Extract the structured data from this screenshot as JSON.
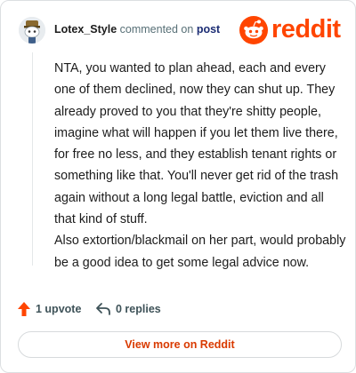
{
  "header": {
    "username": "Lotex_Style",
    "action_text": "commented on",
    "post_link": "post"
  },
  "brand": {
    "wordmark": "reddit",
    "color": "#ff4500"
  },
  "comment": {
    "paragraphs": [
      "NTA, you wanted to plan ahead, each and every one of them declined, now they can shut up. They already proved to you that they're shitty people, imagine what will happen if you let them live there, for free no less, and they establish tenant rights or something like that. You'll never get rid of the trash again without a long legal battle, eviction and all that kind of stuff.",
      "Also extortion/blackmail on her part, would probably be a good idea to get some legal advice now."
    ]
  },
  "actions": {
    "upvote_label": "1 upvote",
    "upvote_icon": "upvote-arrow-icon",
    "reply_label": "0 replies",
    "reply_icon": "reply-arrow-icon"
  },
  "footer": {
    "view_more_label": "View more on Reddit"
  },
  "colors": {
    "accent": "#ff4500",
    "link": "#d93a00",
    "text": "#1c1c1c",
    "muted": "#576f76"
  }
}
